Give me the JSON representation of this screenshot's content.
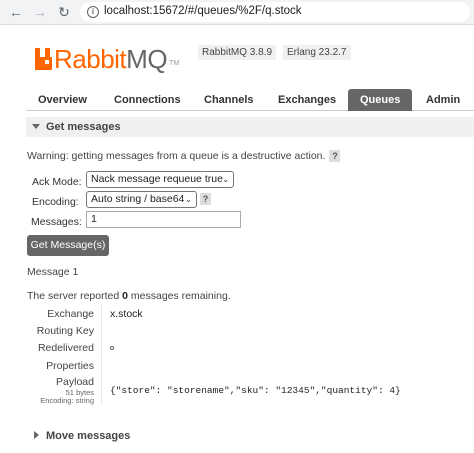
{
  "browser": {
    "url": "localhost:15672/#/queues/%2F/q.stock",
    "back_icon": "arrow-left-icon",
    "forward_icon": "arrow-right-icon",
    "reload_icon": "reload-icon",
    "info_glyph": "i"
  },
  "header": {
    "logo_rabbit": "Rabbit",
    "logo_mq": "MQ",
    "logo_tm": "TM",
    "rabbit_version": "RabbitMQ 3.8.9",
    "erlang_version": "Erlang 23.2.7"
  },
  "tabs": [
    {
      "label": "Overview",
      "active": false
    },
    {
      "label": "Connections",
      "active": false
    },
    {
      "label": "Channels",
      "active": false
    },
    {
      "label": "Exchanges",
      "active": false
    },
    {
      "label": "Queues",
      "active": true
    },
    {
      "label": "Admin",
      "active": false
    }
  ],
  "get_messages": {
    "title": "Get messages",
    "warning": "Warning: getting messages from a queue is a destructive action.",
    "help": "?",
    "ack_mode_label": "Ack Mode:",
    "ack_mode_value": "Nack message requeue true",
    "encoding_label": "Encoding:",
    "encoding_value": "Auto string / base64",
    "messages_label": "Messages:",
    "messages_value": "1",
    "button_label": "Get Message(s)"
  },
  "result": {
    "message_heading": "Message 1",
    "reported_prefix": "The server reported ",
    "reported_count": "0",
    "reported_suffix": " messages remaining.",
    "fields": {
      "exchange_label": "Exchange",
      "exchange_value": "x.stock",
      "routing_key_label": "Routing Key",
      "routing_key_value": "",
      "redelivered_label": "Redelivered",
      "properties_label": "Properties",
      "payload_label": "Payload",
      "payload_size": "51 bytes",
      "payload_encoding": "Encoding: string",
      "payload_value": "{\"store\": \"storename\",\"sku\": \"12345\",\"quantity\": 4}"
    }
  },
  "move_messages": {
    "title": "Move messages"
  },
  "colors": {
    "brand_orange": "#ff6600",
    "tab_active": "#666666",
    "section_bg": "#f0f0f0"
  }
}
